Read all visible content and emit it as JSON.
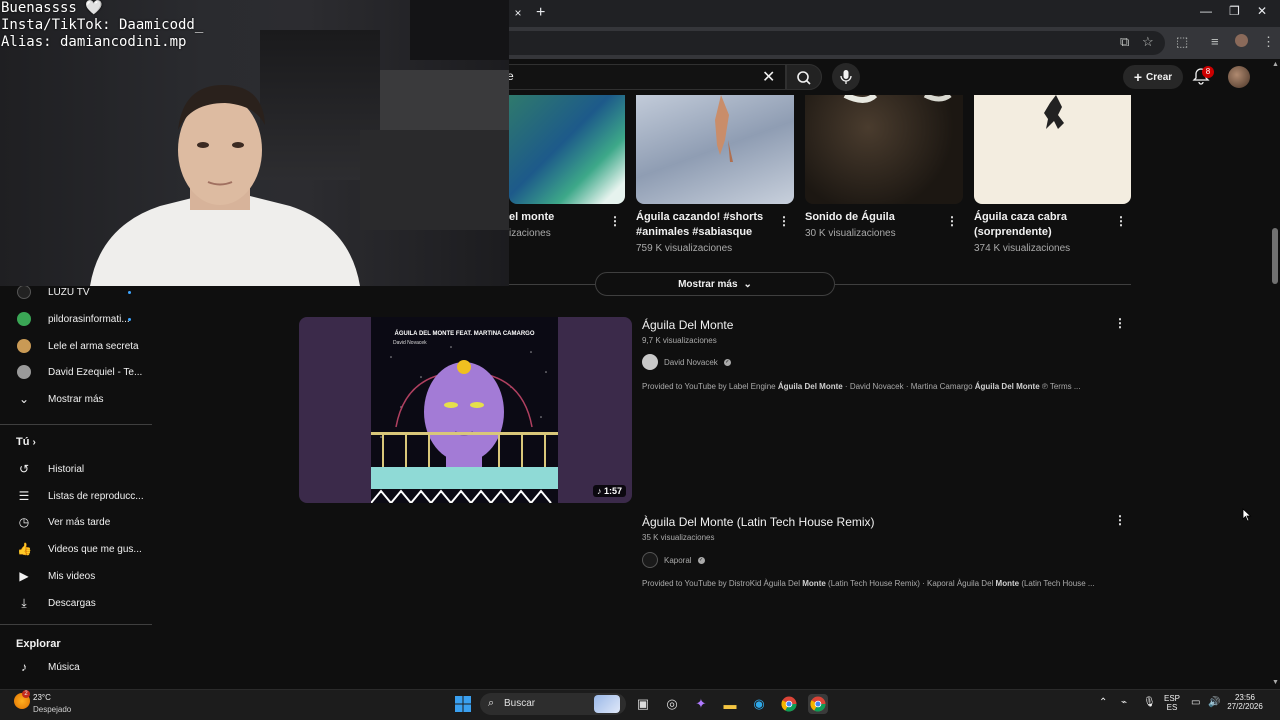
{
  "browser": {
    "tab_close": "×",
    "tab_new": "+"
  },
  "header": {
    "search_value": "e",
    "create_label": "Crear",
    "notifications_count": "8"
  },
  "shorts": [
    {
      "title_line1": "el monte",
      "title_line2": "",
      "views": "izaciones"
    },
    {
      "title_line1": "Águila cazando! #shorts",
      "title_line2": "#animales #sabiasque",
      "views": "759 K visualizaciones"
    },
    {
      "title_line1": "Sonido de Águila",
      "title_line2": "",
      "views": "30 K visualizaciones"
    },
    {
      "title_line1": "Águila caza cabra",
      "title_line2": "(sorprendente)",
      "views": "374 K visualizaciones"
    }
  ],
  "show_more": "Mostrar más",
  "sidebar": {
    "channels": [
      {
        "name": "LUZU TV",
        "color": "#222222"
      },
      {
        "name": "pildorasinformati...",
        "color": "#3aa655"
      },
      {
        "name": "Lele el arma secreta",
        "color": "#c99a55"
      },
      {
        "name": "David Ezequiel - Te...",
        "color": "#9a9a9a"
      }
    ],
    "show_more": "Mostrar más",
    "you_heading": "Tú",
    "you_items": [
      {
        "label": "Historial",
        "icon": "history-icon"
      },
      {
        "label": "Listas de reproducc...",
        "icon": "playlists-icon"
      },
      {
        "label": "Ver más tarde",
        "icon": "watch-later-icon"
      },
      {
        "label": "Videos que me gus...",
        "icon": "liked-icon"
      },
      {
        "label": "Mis videos",
        "icon": "my-videos-icon"
      },
      {
        "label": "Descargas",
        "icon": "downloads-icon"
      }
    ],
    "explore_heading": "Explorar",
    "explore_items": [
      {
        "label": "Música",
        "icon": "music-icon"
      }
    ]
  },
  "results": [
    {
      "title": "Águila Del Monte",
      "views": "9,7 K visualizaciones",
      "channel": "David Novacek",
      "duration": "1:57",
      "art_title": "ÁGUILA DEL MONTE FEAT. MARTINA CAMARGO",
      "art_artist": "David Novacek",
      "desc_pre": "Provided to YouTube by Label Engine ",
      "desc_b1": "Águila Del Monte",
      "desc_mid": " · David Novacek · Martina Camargo ",
      "desc_b2": "Águila Del Monte",
      "desc_post": " ℗ Terms ..."
    },
    {
      "title": "Àguila Del Monte (Latin Tech House Remix)",
      "views": "35 K visualizaciones",
      "channel": "Kaporal",
      "desc_pre": "Provided to YouTube by DistroKid Àguila Del ",
      "desc_b1": "Monte",
      "desc_mid": " (Latin Tech House Remix) · Kaporal Àguila Del ",
      "desc_b2": "Monte",
      "desc_post": " (Latin Tech House ..."
    }
  ],
  "overlay": {
    "line1": "Buenassss 🤍",
    "line2": "Insta/TikTok: Daamicodd_",
    "line3": "Alias: damiancodini.mp"
  },
  "taskbar": {
    "weather_temp": "23°C",
    "weather_desc": "Despejado",
    "search_label": "Buscar",
    "lang_top": "ESP",
    "lang_bottom": "ES",
    "time": "23:56",
    "date": "27/2/2026"
  }
}
